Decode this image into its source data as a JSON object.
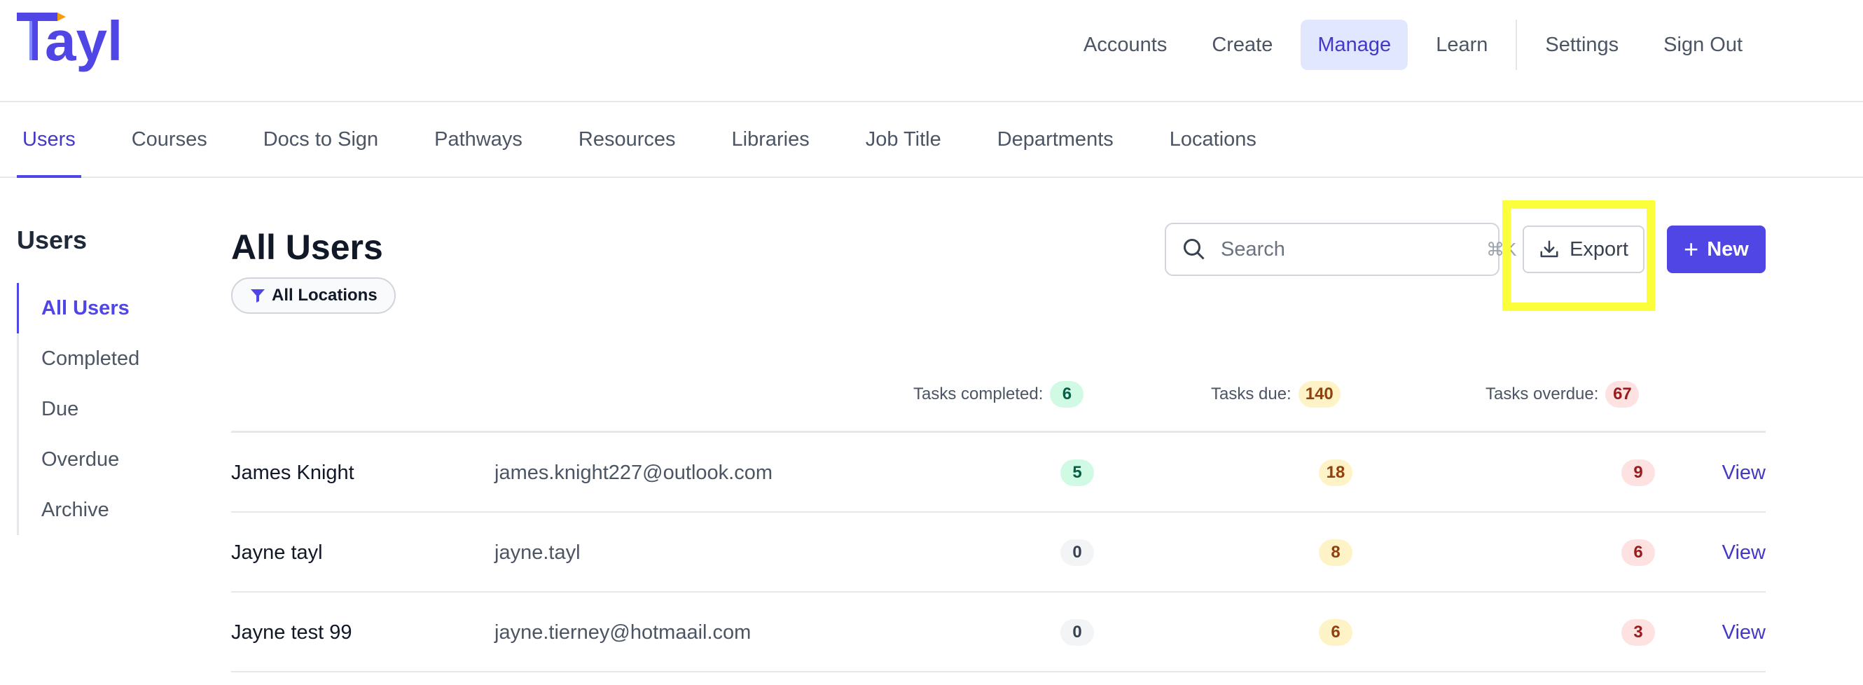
{
  "brand": {
    "logo_text": "Tayl",
    "accent": "#4f46e5"
  },
  "top_nav": {
    "items": [
      "Accounts",
      "Create",
      "Manage",
      "Learn"
    ],
    "secondary": [
      "Settings",
      "Sign Out"
    ],
    "active": "Manage"
  },
  "sub_tabs": {
    "items": [
      "Users",
      "Courses",
      "Docs to Sign",
      "Pathways",
      "Resources",
      "Libraries",
      "Job Title",
      "Departments",
      "Locations"
    ],
    "active": "Users"
  },
  "sidebar": {
    "title": "Users",
    "items": [
      "All Users",
      "Completed",
      "Due",
      "Overdue",
      "Archive"
    ],
    "active": "All Users"
  },
  "main": {
    "title": "All Users",
    "filter_label": "All Locations",
    "search": {
      "placeholder": "Search",
      "shortcut": "⌘K"
    },
    "export_label": "Export",
    "new_label": "New"
  },
  "summary": {
    "completed": {
      "label": "Tasks completed:",
      "value": "6"
    },
    "due": {
      "label": "Tasks due:",
      "value": "140"
    },
    "overdue": {
      "label": "Tasks overdue:",
      "value": "67"
    }
  },
  "users": [
    {
      "name": "James Knight",
      "email": "james.knight227@outlook.com",
      "completed": "5",
      "due": "18",
      "overdue": "9",
      "action": "View"
    },
    {
      "name": "Jayne tayl",
      "email": "jayne.tayl",
      "completed": "0",
      "due": "8",
      "overdue": "6",
      "action": "View"
    },
    {
      "name": "Jayne test 99",
      "email": "jayne.tierney@hotmaail.com",
      "completed": "0",
      "due": "6",
      "overdue": "3",
      "action": "View"
    }
  ]
}
